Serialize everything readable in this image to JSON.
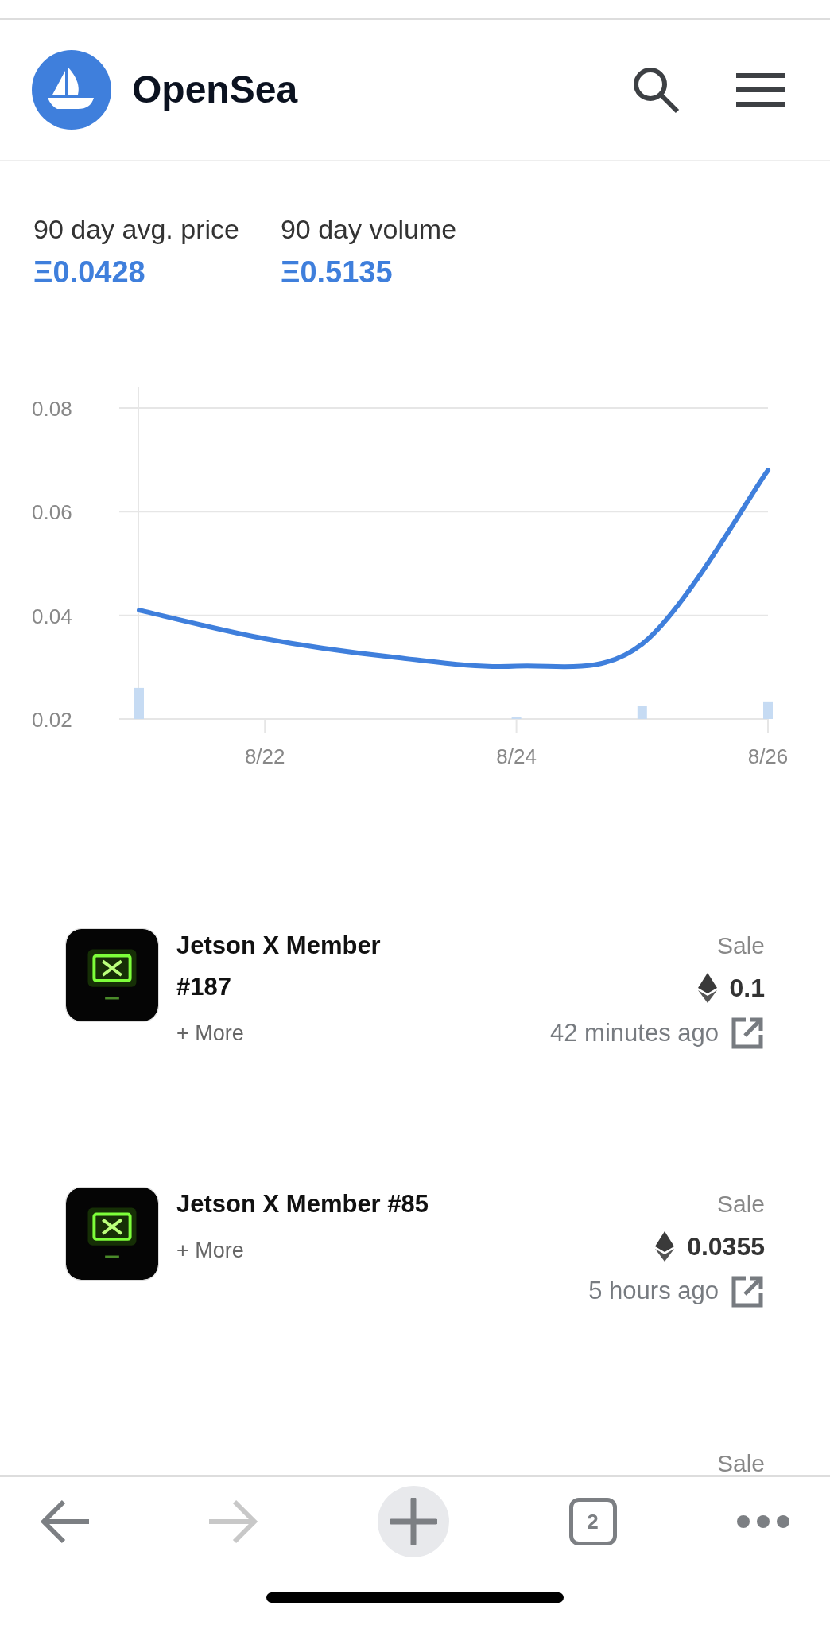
{
  "header": {
    "brand": "OpenSea"
  },
  "stats": [
    {
      "label": "90 day avg. price",
      "value": "Ξ0.0428"
    },
    {
      "label": "90 day volume",
      "value": "Ξ0.5135"
    }
  ],
  "chart": {
    "chart_data": {
      "type": "line",
      "categories": [
        null,
        "8/22",
        null,
        "8/24",
        null,
        "8/26"
      ],
      "yticks": [
        0.02,
        0.04,
        0.06,
        0.08
      ],
      "ylim": [
        0.02,
        0.08
      ],
      "grid": true,
      "series": [
        {
          "type": "line",
          "color": "#3f7fdc",
          "values": [
            0.041,
            0.0355,
            0.032,
            0.0302,
            0.0345,
            0.068
          ]
        },
        {
          "type": "bar",
          "color": "#c6dbf3",
          "values": [
            0.026,
            null,
            null,
            0.0203,
            0.0226,
            0.0234
          ]
        }
      ]
    }
  },
  "events": [
    {
      "title": "Jetson X Member #187",
      "more": "+ More",
      "type": "Sale",
      "price": "0.1",
      "time": "42 minutes ago"
    },
    {
      "title": "Jetson X Member #85",
      "more": "+ More",
      "type": "Sale",
      "price": "0.0355",
      "time": "5 hours ago"
    },
    {
      "type": "Sale"
    }
  ],
  "toolbar": {
    "back": {
      "disabled": false
    },
    "forward": {
      "disabled": true
    },
    "tabs_count": "2"
  }
}
